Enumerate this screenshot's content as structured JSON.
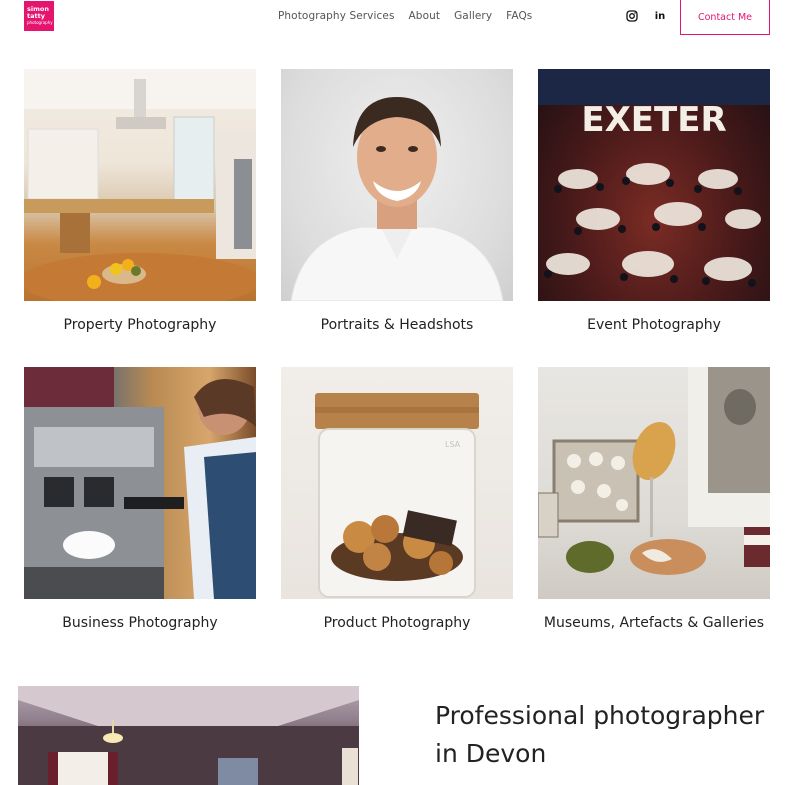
{
  "brand": {
    "logo_line1": "simon",
    "logo_line2": "tatty",
    "logo_line3": "photography",
    "color": "#e5146f"
  },
  "nav": {
    "items": [
      "Photography Services",
      "About",
      "Gallery",
      "FAQs"
    ],
    "social": [
      "instagram-icon",
      "linkedin-icon"
    ],
    "linkedin_label": "in",
    "contact_label": "Contact Me"
  },
  "services": [
    {
      "caption": "Property Photography"
    },
    {
      "caption": "Portraits & Headshots"
    },
    {
      "caption": "Event Photography",
      "sign_text": "EXETER"
    },
    {
      "caption": "Business Photography"
    },
    {
      "caption": "Product Photography",
      "jar_label": "LSA"
    },
    {
      "caption": "Museums, Artefacts & Galleries"
    }
  ],
  "intro": {
    "heading_line1": "Professional photographer",
    "heading_line2": "in Devon"
  }
}
